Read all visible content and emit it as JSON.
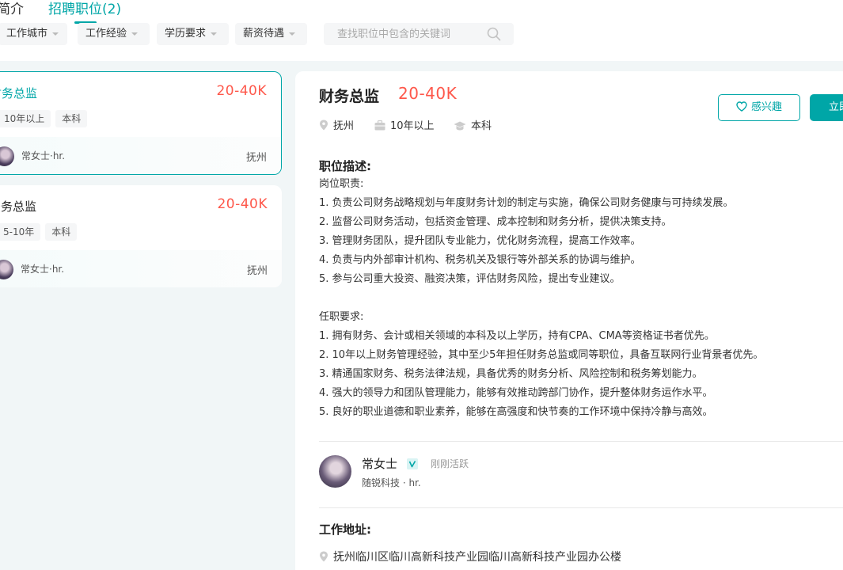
{
  "tabs": {
    "intro": "简介",
    "jobs": "招聘职位(2)"
  },
  "filters": {
    "city": "工作城市",
    "experience": "工作经验",
    "education": "学历要求",
    "salary": "薪资待遇",
    "search_placeholder": "查找职位中包含的关键词"
  },
  "jobs": [
    {
      "title": "财务总监",
      "salary": "20-40K",
      "tags": [
        "10年以上",
        "本科"
      ],
      "hr": "常女士·hr.",
      "city": "抚州"
    },
    {
      "title": "法务总监",
      "salary": "20-40K",
      "tags": [
        "5-10年",
        "本科"
      ],
      "hr": "常女士·hr.",
      "city": "抚州"
    }
  ],
  "detail": {
    "title": "财务总监",
    "salary": "20-40K",
    "location": "抚州",
    "experience": "10年以上",
    "education": "本科",
    "interest_button": "感兴趣",
    "chat_button": "立即沟通",
    "desc_title": "职位描述:",
    "description": "岗位职责:\n1. 负责公司财务战略规划与年度财务计划的制定与实施，确保公司财务健康与可持续发展。\n2. 监督公司财务活动，包括资金管理、成本控制和财务分析，提供决策支持。\n3. 管理财务团队，提升团队专业能力，优化财务流程，提高工作效率。\n4. 负责与内外部审计机构、税务机关及银行等外部关系的协调与维护。\n5. 参与公司重大投资、融资决策，评估财务风险，提出专业建议。\n\n任职要求:\n1. 拥有财务、会计或相关领域的本科及以上学历，持有CPA、CMA等资格证书者优先。\n2. 10年以上财务管理经验，其中至少5年担任财务总监或同等职位，具备互联网行业背景者优先。\n3. 精通国家财务、税务法律法规，具备优秀的财务分析、风险控制和税务筹划能力。\n4. 强大的领导力和团队管理能力，能够有效推动跨部门协作，提升整体财务运作水平。\n5. 良好的职业道德和职业素养，能够在高强度和快节奏的工作环境中保持冷静与高效。",
    "boss": {
      "name": "常女士",
      "status": "刚刚活跃",
      "company": "随锐科技 · hr."
    },
    "address_title": "工作地址:",
    "address": "抚州临川区临川高新科技产业园临川高新科技产业园办公楼"
  },
  "colors": {
    "accent": "#00a6a7",
    "salary": "#fe574a"
  },
  "icons": [
    "search-icon",
    "location-icon",
    "briefcase-icon",
    "graduation-cap-icon",
    "heart-icon",
    "verified-icon"
  ]
}
